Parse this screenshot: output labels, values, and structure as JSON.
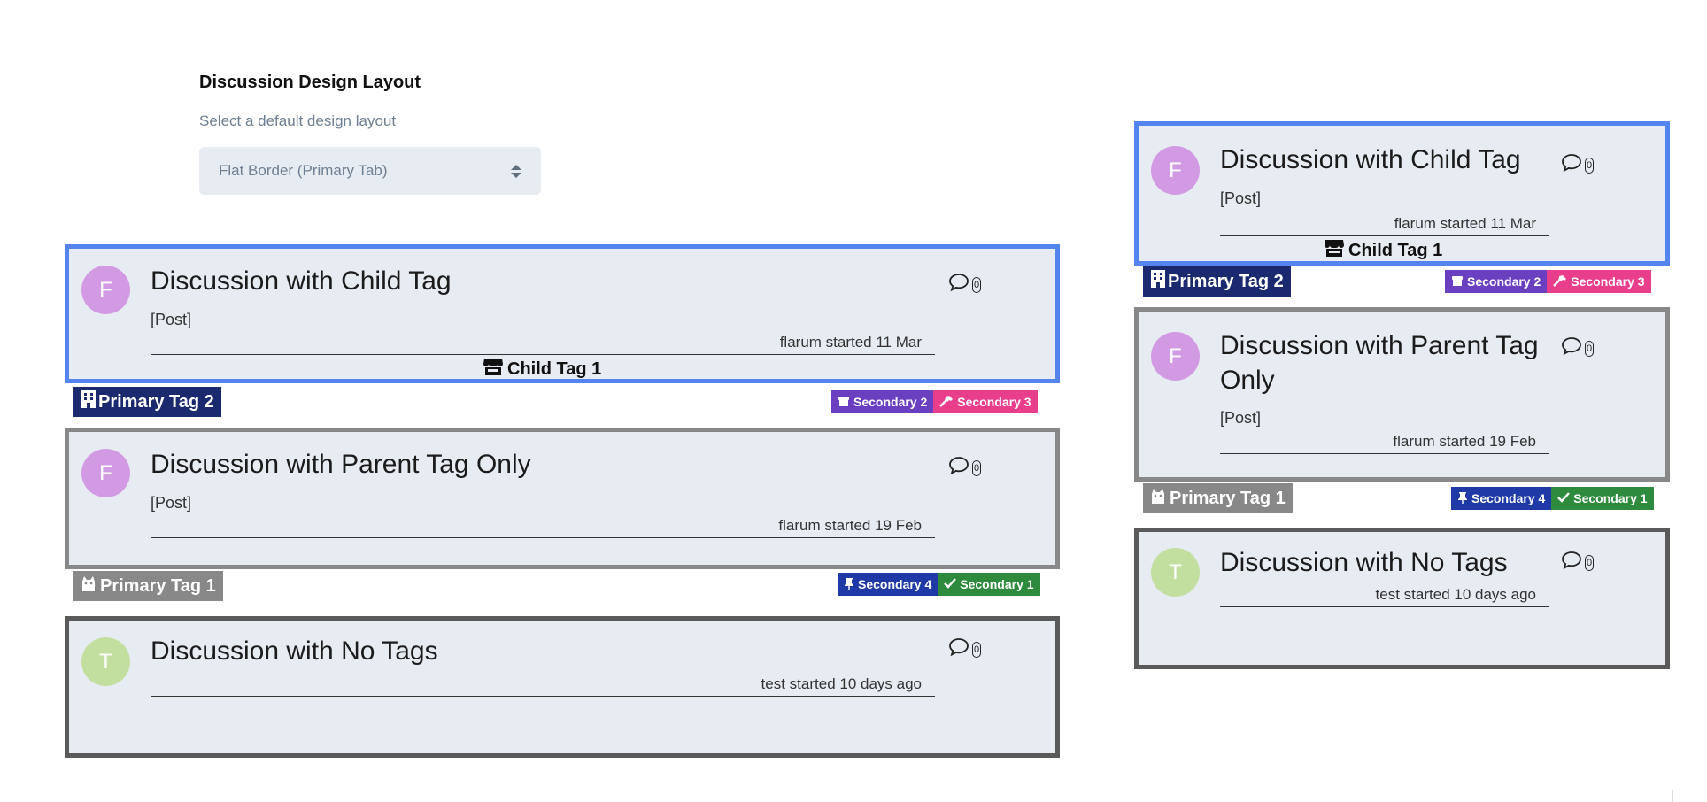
{
  "settings": {
    "heading": "Discussion Design Layout",
    "subheading": "Select a default design layout",
    "select_value": "Flat Border (Primary Tab)"
  },
  "colors": {
    "blue_border": "#5484f0",
    "grey_border": "#888888",
    "dark_border": "#5a5a5a",
    "card_bg": "#e7ecf2",
    "avatar_f": "#d39ae4",
    "avatar_t": "#c3df9f",
    "primary_tag_2": "#1b2a6e",
    "primary_tag_1": "#888888",
    "secondary_2": "#6a3fc0",
    "secondary_3": "#e83e8c",
    "secondary_4": "#1f3aa6",
    "secondary_1": "#2e8b3e"
  },
  "discussions": [
    {
      "avatar": "F",
      "title": "Discussion with Child Tag",
      "excerpt": "[Post]",
      "meta": "flarum started 11 Mar",
      "replies": "0",
      "child_tag": "Child Tag 1",
      "primary_tag": "Primary Tag 2",
      "secondary_tags": [
        "Secondary 2",
        "Secondary 3"
      ]
    },
    {
      "avatar": "F",
      "title": "Discussion with Parent Tag Only",
      "excerpt": "[Post]",
      "meta": "flarum started 19 Feb",
      "replies": "0",
      "primary_tag": "Primary Tag 1",
      "secondary_tags": [
        "Secondary 4",
        "Secondary 1"
      ]
    },
    {
      "avatar": "T",
      "title": "Discussion with No Tags",
      "meta": "test started 10 days ago",
      "replies": "0"
    }
  ],
  "compact_titles": {
    "parent_only_line1": "Discussion with Parent Tag",
    "parent_only_line2": "Only"
  },
  "icons": {
    "comment": "comment-icon",
    "store": "store-icon",
    "building": "building-icon",
    "dumpster": "dumpster-icon",
    "hammer": "hammer-icon",
    "cat": "cat-icon",
    "thumbtack": "thumbtack-icon",
    "check": "check-icon"
  }
}
